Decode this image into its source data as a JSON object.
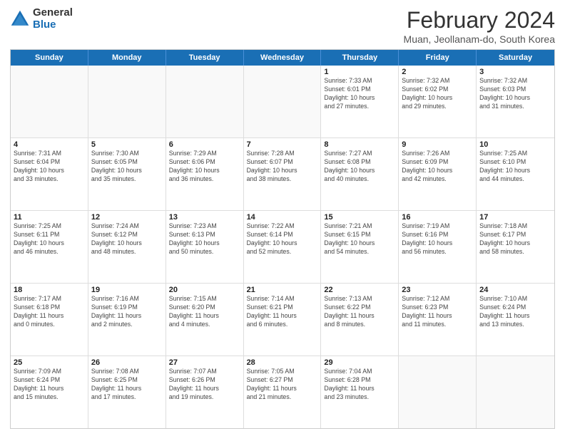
{
  "header": {
    "logo_general": "General",
    "logo_blue": "Blue",
    "title": "February 2024",
    "location": "Muan, Jeollanam-do, South Korea"
  },
  "weekdays": [
    "Sunday",
    "Monday",
    "Tuesday",
    "Wednesday",
    "Thursday",
    "Friday",
    "Saturday"
  ],
  "rows": [
    [
      {
        "day": "",
        "info": ""
      },
      {
        "day": "",
        "info": ""
      },
      {
        "day": "",
        "info": ""
      },
      {
        "day": "",
        "info": ""
      },
      {
        "day": "1",
        "info": "Sunrise: 7:33 AM\nSunset: 6:01 PM\nDaylight: 10 hours\nand 27 minutes."
      },
      {
        "day": "2",
        "info": "Sunrise: 7:32 AM\nSunset: 6:02 PM\nDaylight: 10 hours\nand 29 minutes."
      },
      {
        "day": "3",
        "info": "Sunrise: 7:32 AM\nSunset: 6:03 PM\nDaylight: 10 hours\nand 31 minutes."
      }
    ],
    [
      {
        "day": "4",
        "info": "Sunrise: 7:31 AM\nSunset: 6:04 PM\nDaylight: 10 hours\nand 33 minutes."
      },
      {
        "day": "5",
        "info": "Sunrise: 7:30 AM\nSunset: 6:05 PM\nDaylight: 10 hours\nand 35 minutes."
      },
      {
        "day": "6",
        "info": "Sunrise: 7:29 AM\nSunset: 6:06 PM\nDaylight: 10 hours\nand 36 minutes."
      },
      {
        "day": "7",
        "info": "Sunrise: 7:28 AM\nSunset: 6:07 PM\nDaylight: 10 hours\nand 38 minutes."
      },
      {
        "day": "8",
        "info": "Sunrise: 7:27 AM\nSunset: 6:08 PM\nDaylight: 10 hours\nand 40 minutes."
      },
      {
        "day": "9",
        "info": "Sunrise: 7:26 AM\nSunset: 6:09 PM\nDaylight: 10 hours\nand 42 minutes."
      },
      {
        "day": "10",
        "info": "Sunrise: 7:25 AM\nSunset: 6:10 PM\nDaylight: 10 hours\nand 44 minutes."
      }
    ],
    [
      {
        "day": "11",
        "info": "Sunrise: 7:25 AM\nSunset: 6:11 PM\nDaylight: 10 hours\nand 46 minutes."
      },
      {
        "day": "12",
        "info": "Sunrise: 7:24 AM\nSunset: 6:12 PM\nDaylight: 10 hours\nand 48 minutes."
      },
      {
        "day": "13",
        "info": "Sunrise: 7:23 AM\nSunset: 6:13 PM\nDaylight: 10 hours\nand 50 minutes."
      },
      {
        "day": "14",
        "info": "Sunrise: 7:22 AM\nSunset: 6:14 PM\nDaylight: 10 hours\nand 52 minutes."
      },
      {
        "day": "15",
        "info": "Sunrise: 7:21 AM\nSunset: 6:15 PM\nDaylight: 10 hours\nand 54 minutes."
      },
      {
        "day": "16",
        "info": "Sunrise: 7:19 AM\nSunset: 6:16 PM\nDaylight: 10 hours\nand 56 minutes."
      },
      {
        "day": "17",
        "info": "Sunrise: 7:18 AM\nSunset: 6:17 PM\nDaylight: 10 hours\nand 58 minutes."
      }
    ],
    [
      {
        "day": "18",
        "info": "Sunrise: 7:17 AM\nSunset: 6:18 PM\nDaylight: 11 hours\nand 0 minutes."
      },
      {
        "day": "19",
        "info": "Sunrise: 7:16 AM\nSunset: 6:19 PM\nDaylight: 11 hours\nand 2 minutes."
      },
      {
        "day": "20",
        "info": "Sunrise: 7:15 AM\nSunset: 6:20 PM\nDaylight: 11 hours\nand 4 minutes."
      },
      {
        "day": "21",
        "info": "Sunrise: 7:14 AM\nSunset: 6:21 PM\nDaylight: 11 hours\nand 6 minutes."
      },
      {
        "day": "22",
        "info": "Sunrise: 7:13 AM\nSunset: 6:22 PM\nDaylight: 11 hours\nand 8 minutes."
      },
      {
        "day": "23",
        "info": "Sunrise: 7:12 AM\nSunset: 6:23 PM\nDaylight: 11 hours\nand 11 minutes."
      },
      {
        "day": "24",
        "info": "Sunrise: 7:10 AM\nSunset: 6:24 PM\nDaylight: 11 hours\nand 13 minutes."
      }
    ],
    [
      {
        "day": "25",
        "info": "Sunrise: 7:09 AM\nSunset: 6:24 PM\nDaylight: 11 hours\nand 15 minutes."
      },
      {
        "day": "26",
        "info": "Sunrise: 7:08 AM\nSunset: 6:25 PM\nDaylight: 11 hours\nand 17 minutes."
      },
      {
        "day": "27",
        "info": "Sunrise: 7:07 AM\nSunset: 6:26 PM\nDaylight: 11 hours\nand 19 minutes."
      },
      {
        "day": "28",
        "info": "Sunrise: 7:05 AM\nSunset: 6:27 PM\nDaylight: 11 hours\nand 21 minutes."
      },
      {
        "day": "29",
        "info": "Sunrise: 7:04 AM\nSunset: 6:28 PM\nDaylight: 11 hours\nand 23 minutes."
      },
      {
        "day": "",
        "info": ""
      },
      {
        "day": "",
        "info": ""
      }
    ]
  ]
}
